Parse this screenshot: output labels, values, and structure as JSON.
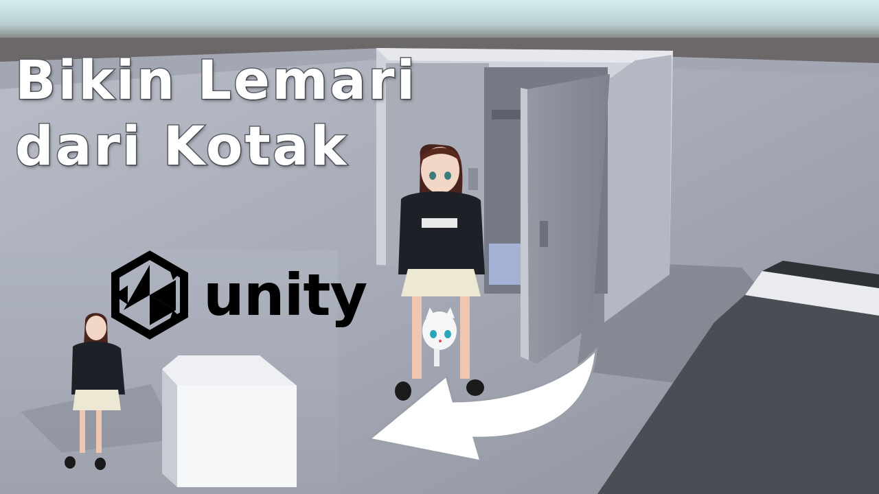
{
  "title": {
    "line1": "Bikin Lemari",
    "line2": "dari Kotak"
  },
  "logo": {
    "icon": "unity-logo-icon",
    "text": "unity"
  },
  "colors": {
    "sky": "#cfe6e8",
    "horizon": "#6e6a6c",
    "floor": "#a6aab6",
    "cabinet": "#d3d7e0",
    "arrow": "#ffffff",
    "title_text": "#ffffff",
    "logo": "#000000"
  }
}
